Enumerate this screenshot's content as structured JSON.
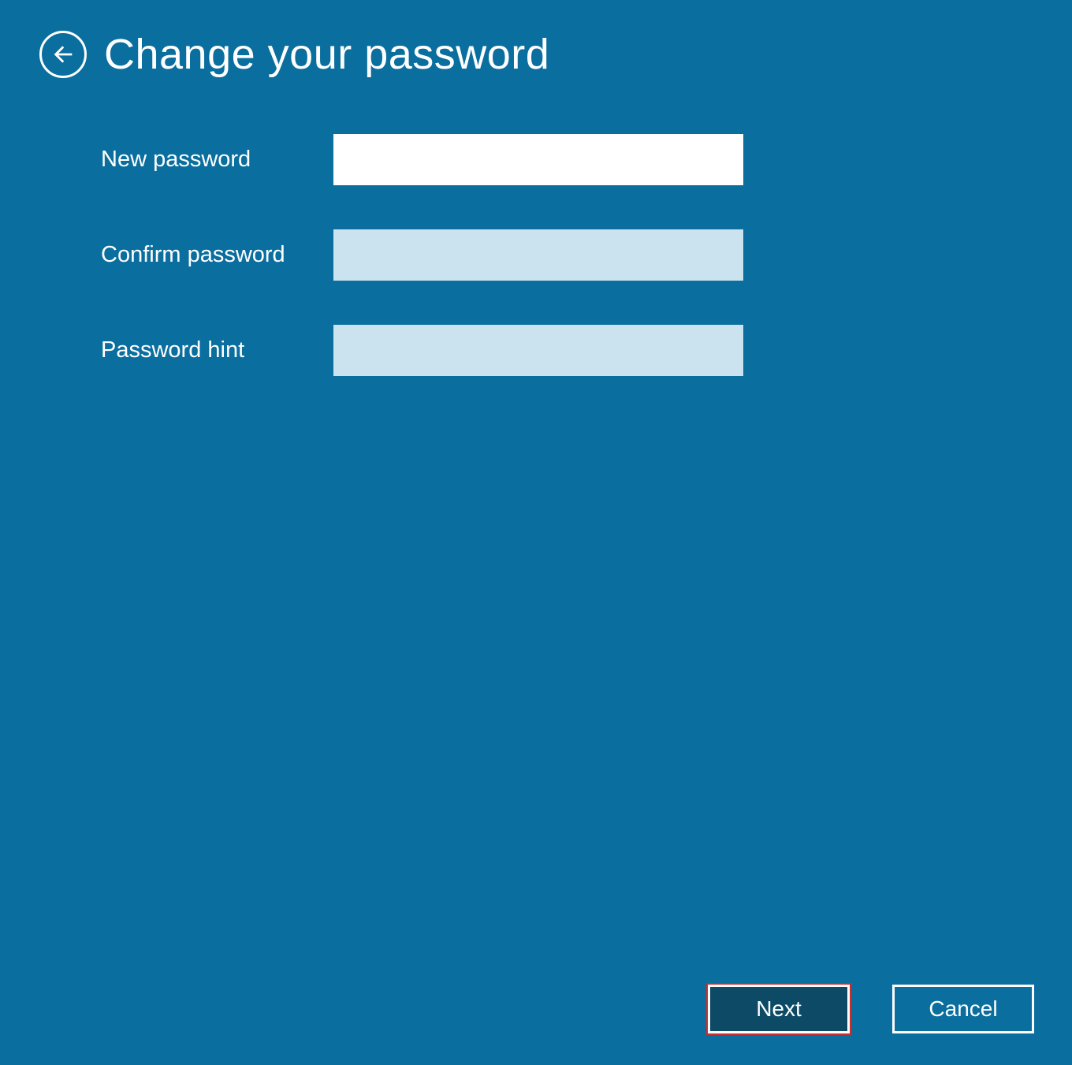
{
  "header": {
    "title": "Change your password"
  },
  "form": {
    "new_password": {
      "label": "New password",
      "value": ""
    },
    "confirm_password": {
      "label": "Confirm password",
      "value": ""
    },
    "password_hint": {
      "label": "Password hint",
      "value": ""
    }
  },
  "footer": {
    "next_label": "Next",
    "cancel_label": "Cancel"
  }
}
